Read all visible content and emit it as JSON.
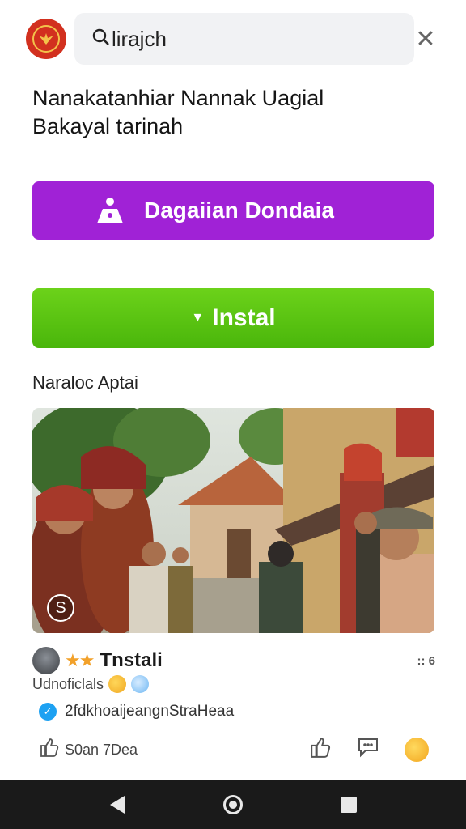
{
  "header": {
    "search_value": "lirajch",
    "close_glyph": "✕"
  },
  "title": {
    "line1": "Nanakatanhiar Nannak Uagial",
    "line2": "Bakayal tarinah"
  },
  "primary_button": {
    "label": "Dagaiian Dondaia",
    "color": "#a022d6"
  },
  "install_button": {
    "label": "Instal",
    "color": "#55bf10"
  },
  "section": {
    "label": "Naraloc Aptai"
  },
  "photo": {
    "badge_glyph": "S"
  },
  "post": {
    "stars": "★★",
    "name": "Tnstali",
    "count": ":: 6",
    "sub": "Udnoficlals",
    "link": "2fdkhoaijeangnStraHeaa",
    "like_label": "S0an 7Dea"
  }
}
